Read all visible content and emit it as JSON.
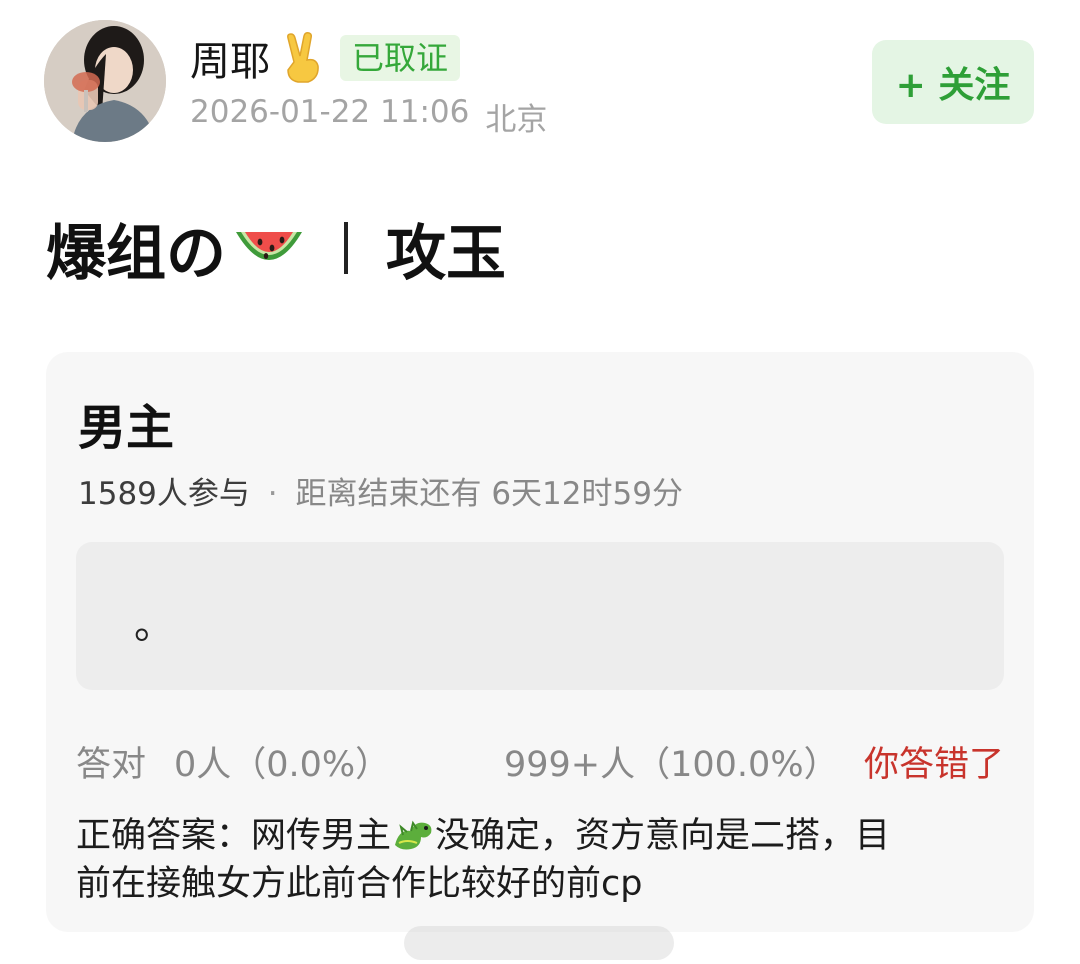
{
  "post": {
    "author": "周耶",
    "verified_badge": "已取证",
    "timestamp": "2026-01-22 11:06",
    "location": "北京",
    "follow_label": "+ 关注",
    "title_left": "爆组の",
    "title_right": "攻玉"
  },
  "quiz": {
    "question": "男主",
    "participants": "1589人参与",
    "separator": "·",
    "time_remaining": "距离结束还有 6天12时59分",
    "option_text": "。",
    "correct_label": "答对",
    "correct_count": "0人（0.0%）",
    "wrong_count": "999+人（100.0%）",
    "wrong_note": "你答错了",
    "answer_line1_prefix": "正确答案：网传男主",
    "answer_line1_suffix": "没确定，资方意向是二搭，目",
    "answer_line2": "前在接触女方此前合作比较好的前cp"
  },
  "icons": {
    "hand": "victory-hand-icon",
    "title_emoji": "watermelon-icon",
    "answer_emoji": "dragon-icon"
  },
  "colors": {
    "accent_green": "#2e9f37",
    "wrong_red": "#c8342c"
  }
}
